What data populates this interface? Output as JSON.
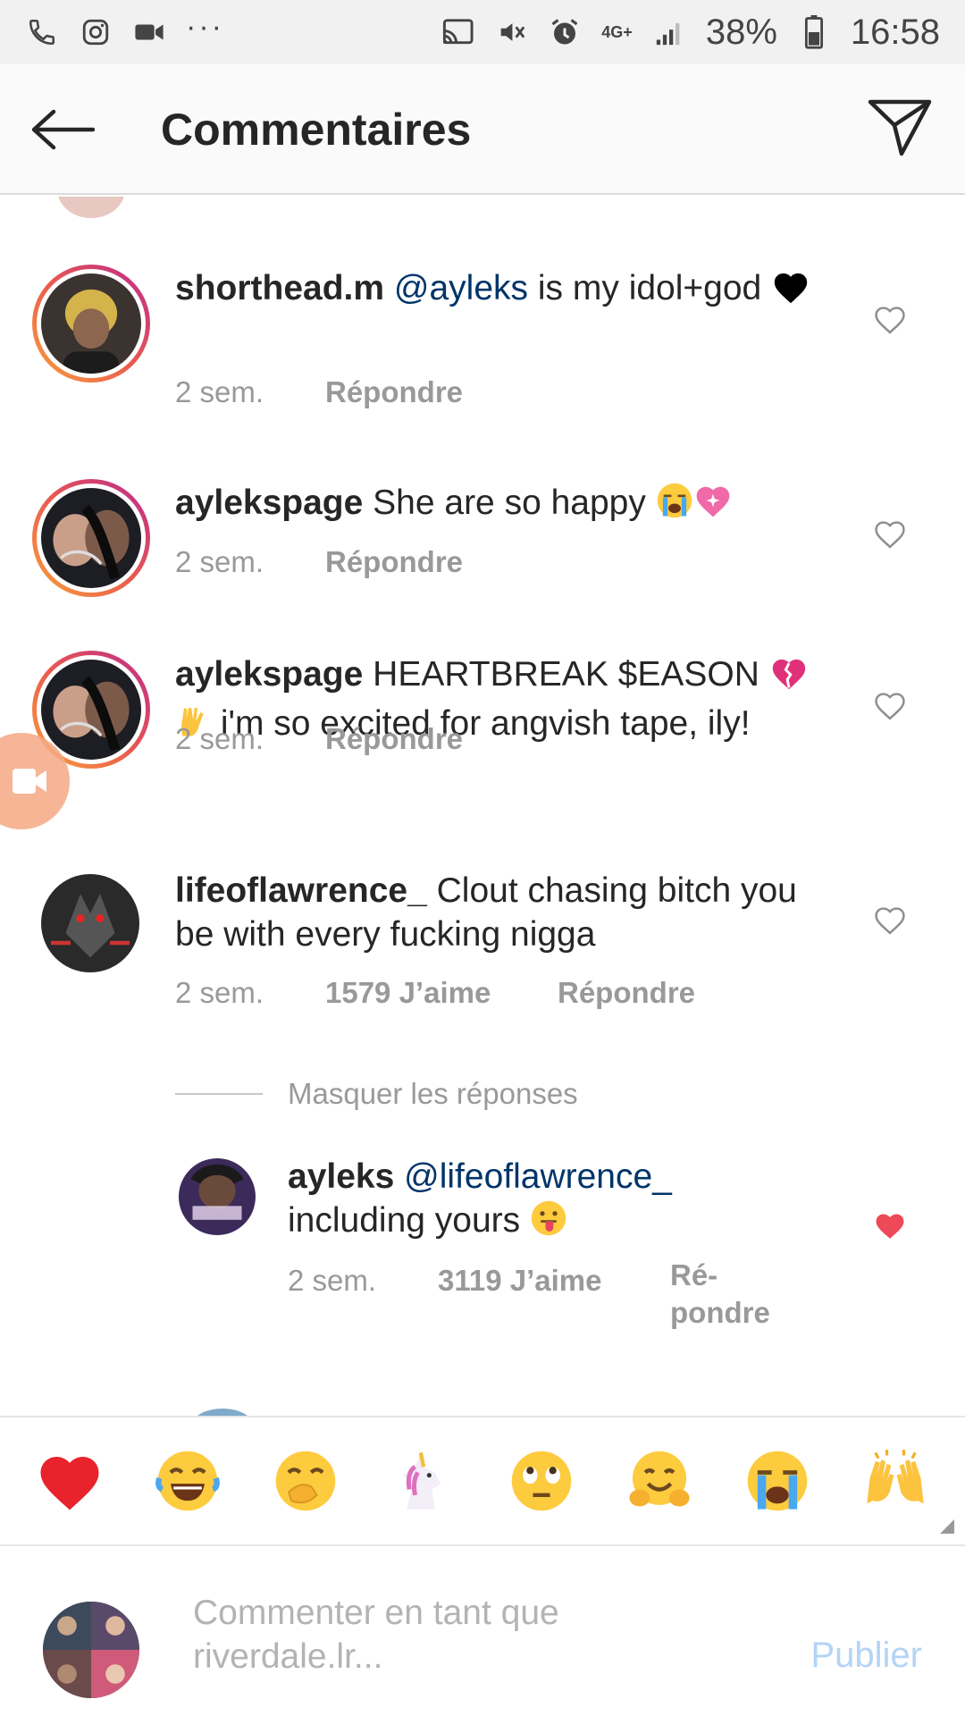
{
  "status_bar": {
    "battery": "38%",
    "time": "16:58",
    "network": "4G+",
    "dots": "···"
  },
  "header": {
    "title": "Commentaires"
  },
  "comments": [
    {
      "username": "shorthead.m",
      "mention": "@ayleks",
      "text_after": " is my idol+god",
      "emojis": [
        "black-heart"
      ],
      "time": "2 sem.",
      "likes": "",
      "reply_label": "Répondre",
      "liked": false
    },
    {
      "username": "aylekspage",
      "mention": "",
      "text_after": " She are so happy",
      "emojis": [
        "loudly-crying-face",
        "sparkling-heart"
      ],
      "time": "2 sem.",
      "likes": "",
      "reply_label": "Répondre",
      "liked": false
    },
    {
      "username": "aylekspage",
      "mention": "",
      "text_before_emoji": " HEARTBREAK $EASON",
      "text_after": " i'm so excited for angvish tape, ily!",
      "emojis": [
        "broken-heart",
        "vulcan-salute"
      ],
      "time": "2 sem.",
      "likes": "",
      "reply_label": "Répondre",
      "liked": false
    },
    {
      "username": "lifeoflawrence_",
      "mention": "",
      "text_after": " Clout chasing bitch you be with every fucking nigga",
      "emojis": [],
      "time": "2 sem.",
      "likes": "1579 J’aime",
      "reply_label": "Répondre",
      "liked": false
    }
  ],
  "hide_replies": "Masquer les réponses",
  "reply": {
    "username": "ayleks",
    "mention": "@lifeoflawrence_",
    "text_after": "including yours",
    "emojis": [
      "face-with-tongue"
    ],
    "time": "2 sem.",
    "likes": "3119 J’aime",
    "reply_label_1": "Ré-",
    "reply_label_2": "pondre",
    "liked": true
  },
  "emoji_bar": [
    "red-heart",
    "tears-of-joy",
    "face-with-hand-over-mouth",
    "unicorn",
    "rolling-eyes",
    "hugging-face",
    "loudly-crying-face",
    "raising-hands"
  ],
  "composer": {
    "placeholder_line1": "Commenter en tant que",
    "placeholder_line2": "riverdale.lr...",
    "publish_label": "Publier"
  },
  "colors": {
    "mention": "#003569",
    "meta_gray": "#999999",
    "liked_heart": "#ed4956",
    "publish_disabled": "#b3d4f5",
    "story_ring": [
      "#f9a23a",
      "#e95950",
      "#bc2a8d"
    ]
  }
}
